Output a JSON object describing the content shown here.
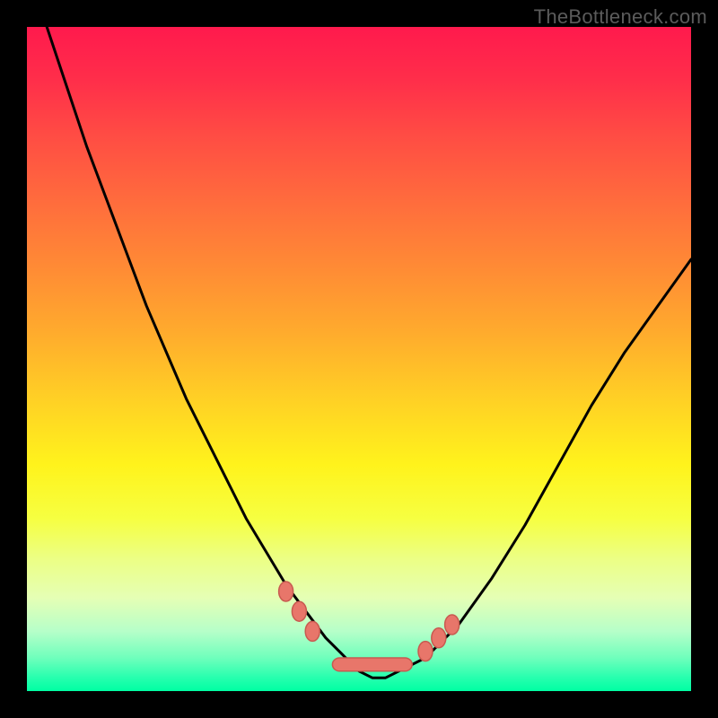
{
  "attribution": "TheBottleneck.com",
  "colors": {
    "frame_bg": "#000000",
    "curve_stroke": "#000000",
    "marker_fill": "#e8766a",
    "marker_stroke": "#c85a50",
    "bar_fill": "#e8766a"
  },
  "chart_data": {
    "type": "line",
    "title": "",
    "xlabel": "",
    "ylabel": "",
    "xlim": [
      0,
      100
    ],
    "ylim": [
      0,
      100
    ],
    "grid": false,
    "series": [
      {
        "name": "curve",
        "x": [
          0,
          3,
          6,
          9,
          12,
          15,
          18,
          21,
          24,
          27,
          30,
          33,
          36,
          39,
          42,
          45,
          48,
          50,
          52,
          54,
          56,
          60,
          65,
          70,
          75,
          80,
          85,
          90,
          95,
          100
        ],
        "y": [
          110,
          100,
          91,
          82,
          74,
          66,
          58,
          51,
          44,
          38,
          32,
          26,
          21,
          16,
          12,
          8,
          5,
          3,
          2,
          2,
          3,
          5,
          10,
          17,
          25,
          34,
          43,
          51,
          58,
          65
        ]
      }
    ],
    "markers": [
      {
        "name": "left-dot-1",
        "x": 39,
        "y": 15.0
      },
      {
        "name": "left-dot-2",
        "x": 41,
        "y": 12.0
      },
      {
        "name": "left-dot-3",
        "x": 43,
        "y": 9.0
      },
      {
        "name": "right-dot-1",
        "x": 60,
        "y": 6.0
      },
      {
        "name": "right-dot-2",
        "x": 62,
        "y": 8.0
      },
      {
        "name": "right-dot-3",
        "x": 64,
        "y": 10.0
      }
    ],
    "valley_bar": {
      "x_start": 46,
      "x_end": 58,
      "y": 3,
      "height": 2
    }
  }
}
